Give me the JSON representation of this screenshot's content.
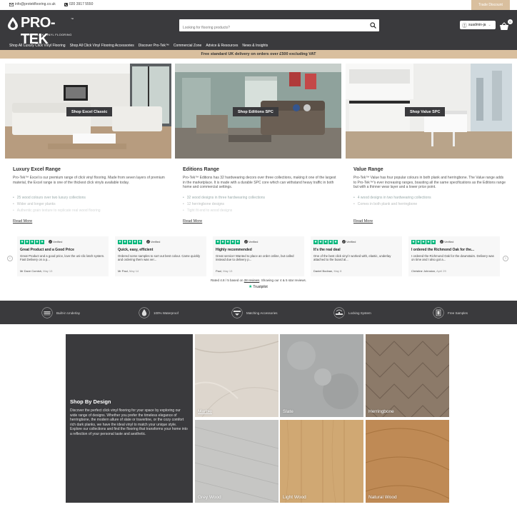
{
  "topbar": {
    "email": "info@protekflooring.co.uk",
    "phone": "020 3917 5550",
    "trade_label": "Trade Discount"
  },
  "header": {
    "brand": "PRO-TEK",
    "tm": "™",
    "tagline": "LUXURY CLICK VINYL FLOORING",
    "search_placeholder": "Looking for flooring products?",
    "account_label": "suadmin-ja",
    "cart_count": "0"
  },
  "nav": {
    "items": [
      "Shop All Luxury Click Vinyl Flooring",
      "Shop All Click Vinyl Flooring Accessories",
      "Discover Pro-Tek™",
      "Commercial Zone",
      "Advice & Resources",
      "News & Insights"
    ]
  },
  "promo": {
    "text": "Free standard UK delivery on orders over £500 excluding VAT"
  },
  "ranges": [
    {
      "button": "Shop Excel Classic",
      "title": "Luxury Excel Range",
      "description": "Pro-Tek™ Excel is our premium range of click vinyl flooring. Made from seven layers of premium material, the Excel range is one of the thickest click vinyls available today.",
      "bullets": [
        "25 wood colours over two luxury collections",
        "Wider and longer planks",
        "Authentic grain texture to replicate real wood flooring"
      ],
      "more": "Read More"
    },
    {
      "button": "Shop Editions SPC",
      "title": "Editions Range",
      "description": "Pro-Tek™ Editions has 32 hardwearing decors over three collections, making it one of the largest in the marketplace. It is made with a durable SPC core which can withstand heavy traffic in both home and commercial settings.",
      "bullets": [
        "32 wood designs in three hardwearing collections",
        "12 herringbone designs",
        "Tight fit end to wood designs"
      ],
      "more": "Read More"
    },
    {
      "button": "Shop Value SPC",
      "title": "Value Range",
      "description": "Pro-Tek™ Value has four popular colours in both plank and herringbone. The Value range adds to Pro-Tek™'s ever increasing ranges, boasting all the same specifications as the Editions range but with a thinner wear layer and a lower price point.",
      "bullets": [
        "4 wood designs in two hardwearing collections",
        "Comes in both plank and herringbone"
      ],
      "more": "Read More"
    }
  ],
  "reviews": {
    "verified_label": "Verified",
    "items": [
      {
        "title": "Great Product and a Good Price",
        "body": "Great Product and a good price, love the uni-clic latch system. Fast Delivery on a p...",
        "author": "Mr Dave Cornish,",
        "date": "May 13"
      },
      {
        "title": "Quick, easy, efficient",
        "body": "Ordered some samples to sort out best colour. Came quickly and ordering them was ver...",
        "author": "Mr Paul,",
        "date": "May 14"
      },
      {
        "title": "Highly recommended",
        "body": "Great service! Wanted to place an order online, but called instead due to delivery p...",
        "author": "Paul,",
        "date": "May 13"
      },
      {
        "title": "It's the real deal",
        "body": "One of the best click vinyl I worked with, elastic, underlay attached to the board al...",
        "author": "Daniel Bodnan,",
        "date": "May 8"
      },
      {
        "title": "I ordered the Richmond Oak for the...",
        "body": "I ordered the Richmond Oak for the downstairs. Delivery was on time and I also got a...",
        "author": "Christine Johnston,",
        "date": "April 29"
      }
    ],
    "summary_prefix": "Rated 4.8 / 5 based on",
    "summary_link": "28 reviews",
    "summary_suffix": ". Showing our 4 & 5 star reviews.",
    "trustpilot": "Trustpilot"
  },
  "features": [
    "Built-in Underlay",
    "100% Waterproof",
    "Matching Accessories",
    "Locking System",
    "Free Samples"
  ],
  "designs": {
    "title": "Shop By Design",
    "description": "Discover the perfect click vinyl flooring for your space by exploring our wide range of designs. Whether you prefer the timeless elegance of herringbone, the modern allure of slate or travertine, or the cozy comfort rich dark planks, we have the ideal vinyl to match your unique style. Explore our collections and find the flooring that transforms your home into a reflection of your personal taste and aesthetic.",
    "tiles": [
      "Marble",
      "Slate",
      "Herringbone",
      "Grey Wood",
      "Light Wood",
      "Natural Wood"
    ]
  },
  "colors": {
    "dark": "#3a3a3d",
    "accent": "#d9bf9e",
    "trustpilot_green": "#00b67a"
  }
}
